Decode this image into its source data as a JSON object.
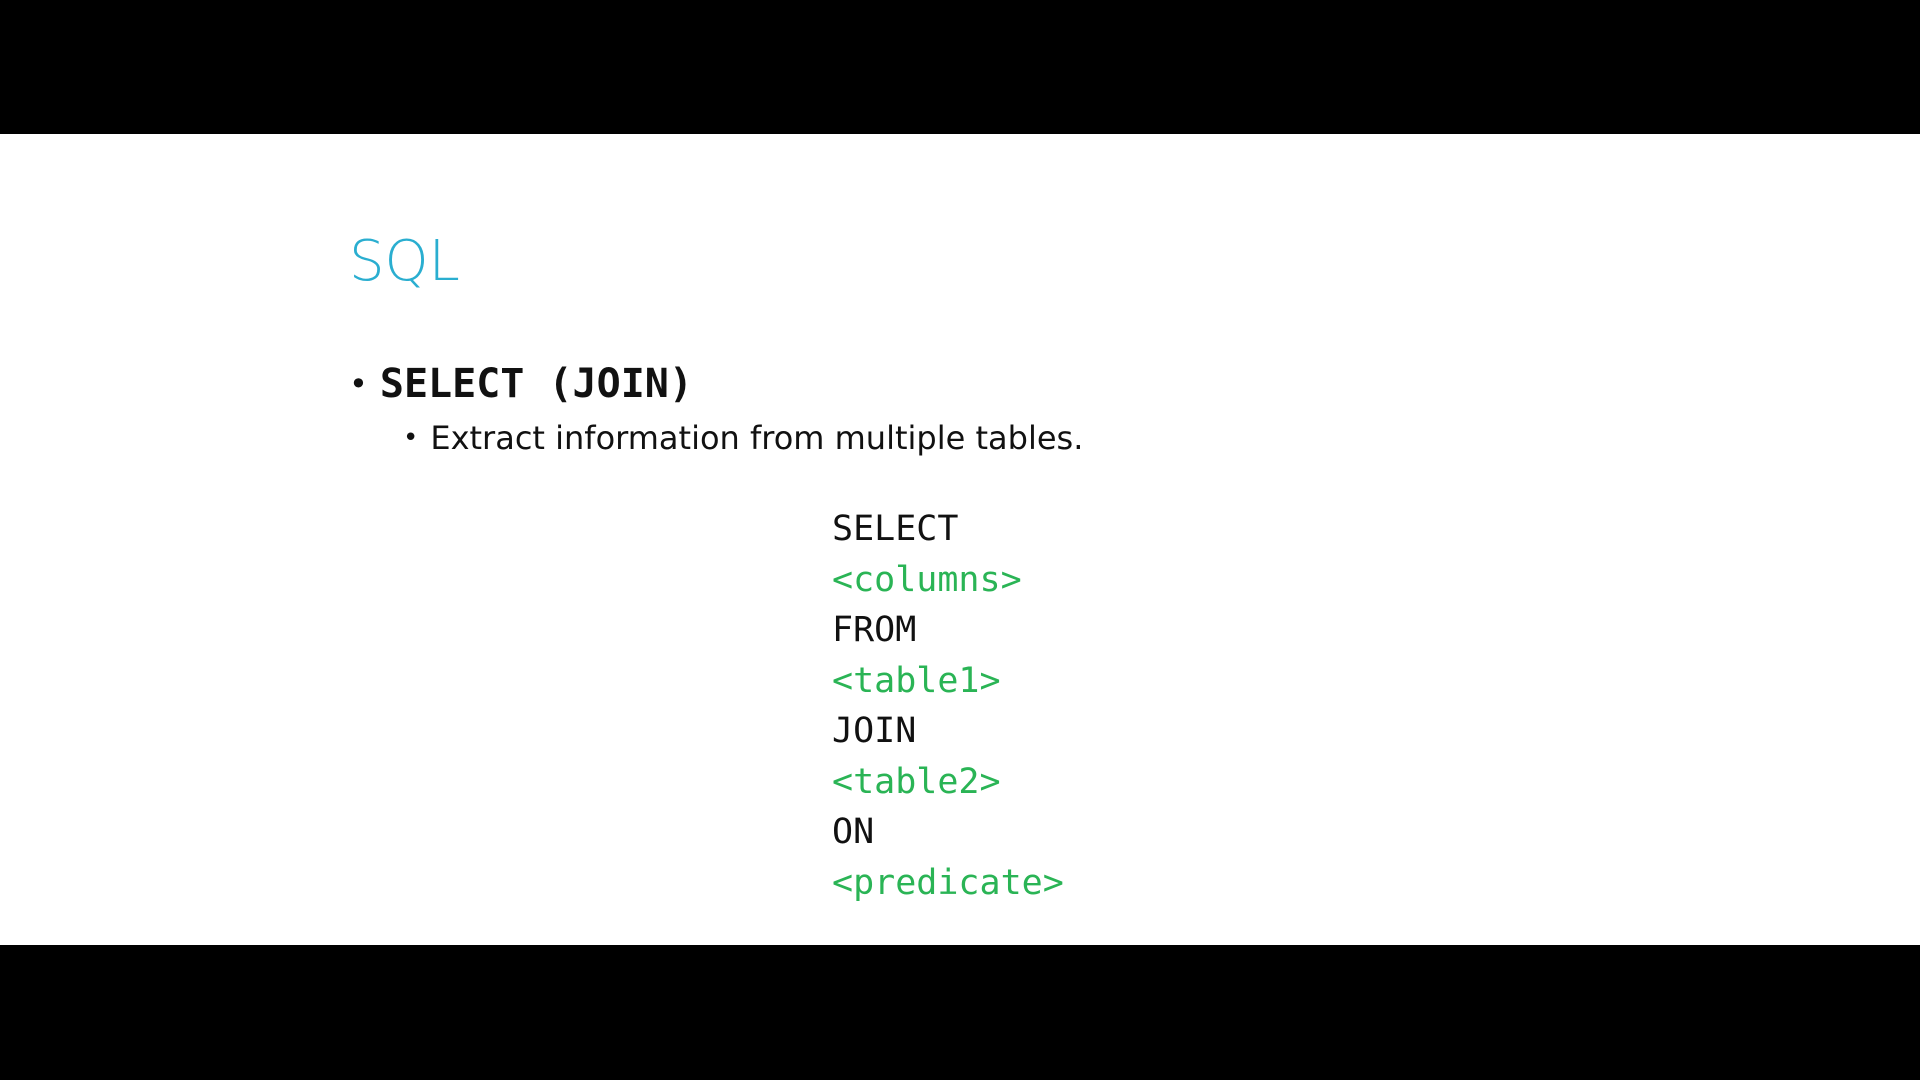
{
  "slide": {
    "title": "SQL",
    "bullet": {
      "symbol": "•",
      "text": "SELECT (JOIN)",
      "sub_bullet": {
        "symbol": "•",
        "text": "Extract information from multiple tables."
      }
    },
    "code_lines": [
      {
        "text": "SELECT",
        "kind": "keyword"
      },
      {
        "text": "<columns>",
        "kind": "placeholder"
      },
      {
        "text": "FROM",
        "kind": "keyword"
      },
      {
        "text": "<table1>",
        "kind": "placeholder"
      },
      {
        "text": "JOIN",
        "kind": "keyword"
      },
      {
        "text": "<table2>",
        "kind": "placeholder"
      },
      {
        "text": "ON",
        "kind": "keyword"
      },
      {
        "text": "<predicate>",
        "kind": "placeholder"
      }
    ]
  },
  "colors": {
    "title": "#2aaed0",
    "keyword": "#111111",
    "placeholder": "#2ab455",
    "background": "#ffffff",
    "letterbox": "#000000"
  }
}
